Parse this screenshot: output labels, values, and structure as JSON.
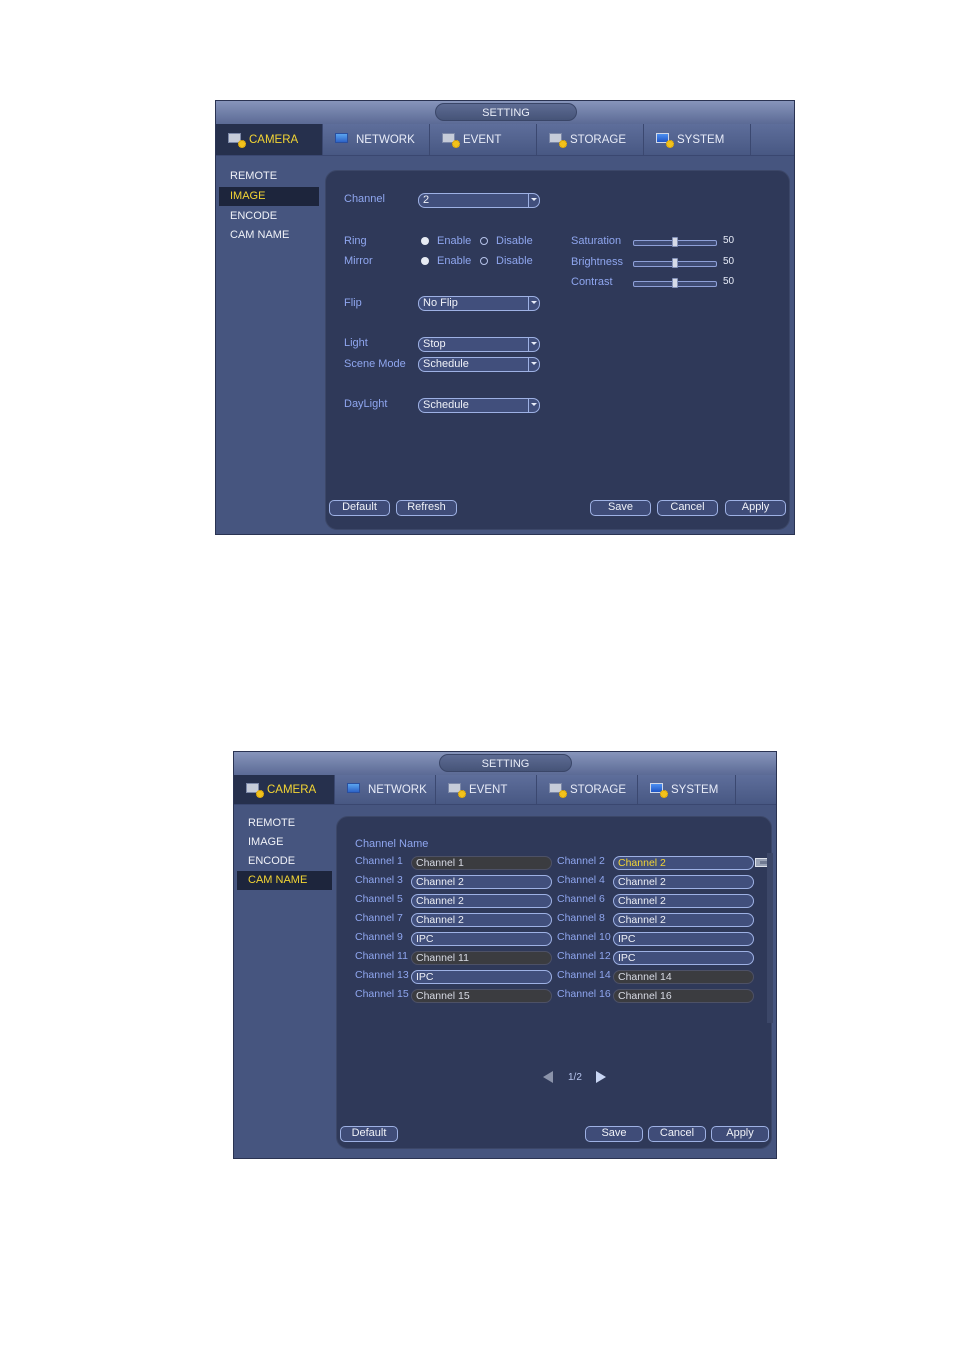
{
  "screen1": {
    "title": "SETTING",
    "tabs": [
      {
        "label": "CAMERA",
        "icon": "camera-icon",
        "active": true
      },
      {
        "label": "NETWORK",
        "icon": "network-icon",
        "active": false
      },
      {
        "label": "EVENT",
        "icon": "event-icon",
        "active": false
      },
      {
        "label": "STORAGE",
        "icon": "storage-icon",
        "active": false
      },
      {
        "label": "SYSTEM",
        "icon": "system-icon",
        "active": false
      }
    ],
    "sidebar": [
      {
        "label": "REMOTE",
        "active": false
      },
      {
        "label": "IMAGE",
        "active": true
      },
      {
        "label": "ENCODE",
        "active": false
      },
      {
        "label": "CAM NAME",
        "active": false
      }
    ],
    "form": {
      "channel_label": "Channel",
      "channel_value": "2",
      "ring_label": "Ring",
      "ring_value": "Enable",
      "mirror_label": "Mirror",
      "mirror_value": "Enable",
      "enable_label": "Enable",
      "disable_label": "Disable",
      "flip_label": "Flip",
      "flip_value": "No Flip",
      "light_label": "Light",
      "light_value": "Stop",
      "scene_label": "Scene Mode",
      "scene_value": "Schedule",
      "daylight_label": "DayLight",
      "daylight_value": "Schedule",
      "sliders": [
        {
          "label": "Saturation",
          "value": 50,
          "max": 100
        },
        {
          "label": "Brightness",
          "value": 50,
          "max": 100
        },
        {
          "label": "Contrast",
          "value": 50,
          "max": 100
        }
      ]
    },
    "buttons": {
      "default": "Default",
      "refresh": "Refresh",
      "save": "Save",
      "cancel": "Cancel",
      "apply": "Apply"
    }
  },
  "screen2": {
    "title": "SETTING",
    "tabs": [
      {
        "label": "CAMERA",
        "active": true
      },
      {
        "label": "NETWORK",
        "active": false
      },
      {
        "label": "EVENT",
        "active": false
      },
      {
        "label": "STORAGE",
        "active": false
      },
      {
        "label": "SYSTEM",
        "active": false
      }
    ],
    "sidebar": [
      {
        "label": "REMOTE",
        "active": false
      },
      {
        "label": "IMAGE",
        "active": false
      },
      {
        "label": "ENCODE",
        "active": false
      },
      {
        "label": "CAM NAME",
        "active": true
      }
    ],
    "heading": "Channel Name",
    "channels": [
      {
        "label": "Channel 1",
        "value": "Channel 1",
        "editable": false
      },
      {
        "label": "Channel 2",
        "value": "Channel 2",
        "editable": true,
        "focused": true
      },
      {
        "label": "Channel 3",
        "value": "Channel 2",
        "editable": true
      },
      {
        "label": "Channel 4",
        "value": "Channel 2",
        "editable": true
      },
      {
        "label": "Channel 5",
        "value": "Channel 2",
        "editable": true
      },
      {
        "label": "Channel 6",
        "value": "Channel 2",
        "editable": true
      },
      {
        "label": "Channel 7",
        "value": "Channel 2",
        "editable": true
      },
      {
        "label": "Channel 8",
        "value": "Channel 2",
        "editable": true
      },
      {
        "label": "Channel 9",
        "value": "IPC",
        "editable": true
      },
      {
        "label": "Channel 10",
        "value": "IPC",
        "editable": true
      },
      {
        "label": "Channel 11",
        "value": "Channel 11",
        "editable": false
      },
      {
        "label": "Channel 12",
        "value": "IPC",
        "editable": true
      },
      {
        "label": "Channel 13",
        "value": "IPC",
        "editable": true
      },
      {
        "label": "Channel 14",
        "value": "Channel 14",
        "editable": false
      },
      {
        "label": "Channel 15",
        "value": "Channel 15",
        "editable": false
      },
      {
        "label": "Channel 16",
        "value": "Channel 16",
        "editable": false
      }
    ],
    "pager": "1/2",
    "buttons": {
      "default": "Default",
      "save": "Save",
      "cancel": "Cancel",
      "apply": "Apply"
    }
  }
}
